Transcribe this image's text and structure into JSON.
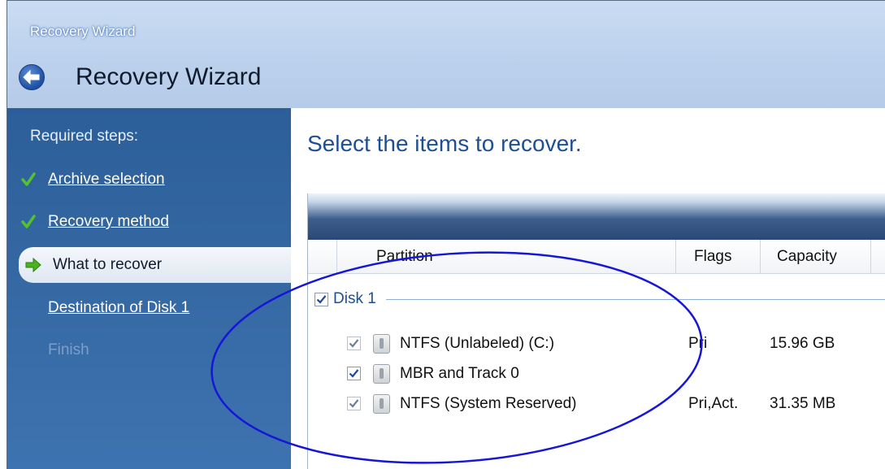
{
  "window": {
    "title_small": "Recovery Wizard",
    "title": "Recovery Wizard"
  },
  "sidebar": {
    "heading": "Required steps:",
    "steps": [
      {
        "label": "Archive selection",
        "state": "done",
        "icon": "check-icon"
      },
      {
        "label": "Recovery method",
        "state": "done",
        "icon": "check-icon"
      },
      {
        "label": "What to recover",
        "state": "current",
        "icon": "arrow-right-icon"
      },
      {
        "label": "Destination of Disk 1",
        "state": "next"
      },
      {
        "label": "Finish",
        "state": "disabled"
      }
    ]
  },
  "main": {
    "title": "Select the items to recover.",
    "columns": [
      "Partition",
      "Flags",
      "Capacity"
    ],
    "disk": {
      "label": "Disk 1",
      "checked": true
    },
    "partitions": [
      {
        "name": "NTFS (Unlabeled) (C:)",
        "flags": "Pri",
        "capacity": "15.96 GB",
        "checked": true
      },
      {
        "name": "MBR and Track 0",
        "flags": "",
        "capacity": "",
        "checked": true
      },
      {
        "name": "NTFS (System Reserved)",
        "flags": "Pri,Act.",
        "capacity": "31.35 MB",
        "checked": true
      }
    ]
  },
  "colors": {
    "sidebar": "#3466a2",
    "header": "#c0d4ee",
    "title_blue": "#1f4f93",
    "highlight_ellipse": "#1a1ad6",
    "check_green": "#3a9a1e"
  }
}
